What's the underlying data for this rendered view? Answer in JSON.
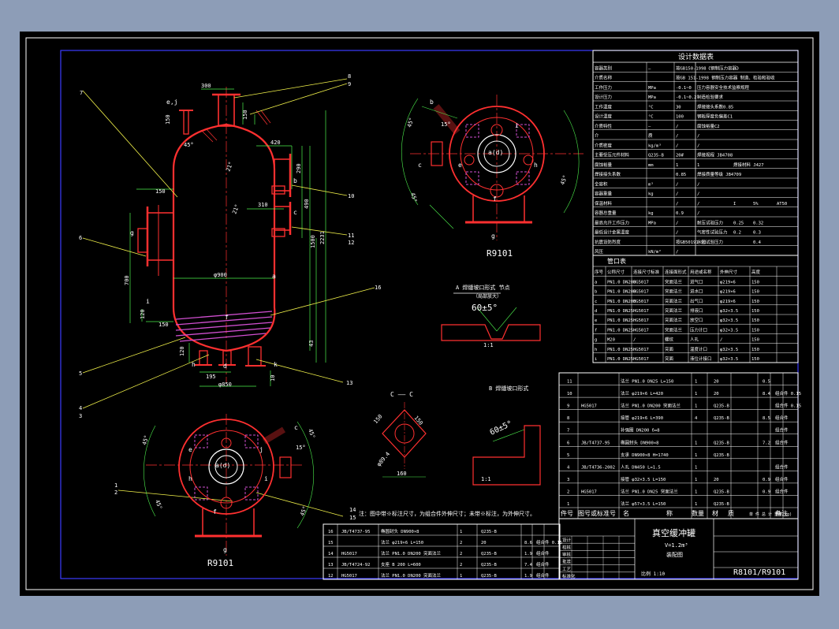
{
  "colors": {
    "background": "#8d9db7",
    "sheet": "#000000",
    "vessel": "#ff3030",
    "dimension": "#4df04d",
    "leader": "#f2f24a",
    "border_inner": "#3c3cff",
    "table": "#ffffff",
    "nozzle_hatch": "#d04fd0",
    "centerline": "#ff3030",
    "flange": "#b060ff"
  },
  "front_view": {
    "dims": {
      "d300": "300",
      "d150a": "150",
      "d150b": "150",
      "d420": "420",
      "d290": "290",
      "d310": "310",
      "d490": "490",
      "d1500": "1500",
      "d2231": "2231",
      "d150c": "150",
      "d700": "700",
      "d900": "φ900",
      "d120": "120",
      "d150d": "150",
      "d120b": "120",
      "d195": "195",
      "d850": "φ850",
      "d10": "10",
      "d43": "43",
      "d45": "45°",
      "angle21a": "21°",
      "angle21b": "21°"
    },
    "letters": {
      "ej": "e,j",
      "b": "b",
      "c": "c",
      "g": "g",
      "a": "a",
      "d": "d",
      "h": "h",
      "i": "i",
      "k": "k",
      "f": "f"
    },
    "callouts": [
      "7",
      "8",
      "9",
      "10",
      "11",
      "12",
      "6",
      "16",
      "5",
      "13",
      "4",
      "3",
      "1",
      "2",
      "14",
      "15"
    ]
  },
  "top_view": {
    "label": "R9101",
    "letters": [
      "b",
      "c",
      "e",
      "a(d)",
      "h",
      "f",
      "g",
      "i"
    ],
    "angles": [
      "45°",
      "45°",
      "15°",
      "45°"
    ]
  },
  "bottom_view": {
    "label": "R9101",
    "letters": [
      "e",
      "a(d)",
      "j",
      "h",
      "f",
      "g",
      "i",
      "c"
    ],
    "angles": [
      "45°",
      "45°",
      "15°",
      "45°",
      "45°"
    ]
  },
  "details": {
    "weld_a_title": "A 焊缝坡口形式 节点",
    "weld_a_sub": "（局部放大）",
    "weld_a_angle": "60±5°",
    "weld_a_scale": "1:1",
    "section_c_title": "C —— C",
    "section_c_dims": [
      "150",
      "150",
      "160",
      "φ89.4"
    ],
    "weld_b_title": "B 焊缝坡口形式",
    "weld_b_angle": "60±5°",
    "weld_b_scale": "1:1"
  },
  "design_table": {
    "title": "设计数据表",
    "rows": [
      [
        "容器类别",
        "—",
        "按GB150-1998《钢制压力容器》"
      ],
      [
        "介质名称",
        "",
        "按GB 151-1998 钢制压力容器 制造、检验和验收"
      ],
      [
        "工作压力",
        "MPa",
        "-0.1~0",
        "压力容器安全技术监察规程"
      ],
      [
        "设计压力",
        "MPa",
        "-0.1~0.2",
        "制造检验要求"
      ],
      [
        "工作温度",
        "°C",
        "30",
        "焊接接头系数0.85"
      ],
      [
        "设计温度",
        "°C",
        "100",
        "钢板厚度负偏差C1"
      ],
      [
        "介质特性",
        "—",
        "/",
        "腐蚀裕量C2"
      ],
      [
        "介",
        "质",
        "/",
        "/"
      ],
      [
        "介质密度",
        "kg/m³",
        "/",
        "/"
      ],
      [
        "主要受压元件材料",
        "Q235-B",
        "20#",
        "焊接规程 JB4708"
      ],
      [
        "腐蚀裕量",
        "mm",
        "1",
        "1",
        "焊接材料 J427"
      ],
      [
        "焊接接头系数",
        "",
        "0.85",
        "焊接质量等级 JB4709"
      ],
      [
        "全容积",
        "m³",
        "/",
        "/"
      ],
      [
        "容器重量",
        "kg",
        "/",
        "/"
      ],
      [
        "保温材料",
        "",
        "/",
        "/",
        "I",
        "5%",
        "AT50",
        "I-II"
      ],
      [
        "容器总重量",
        "kg",
        "0.9",
        "/"
      ],
      [
        "最高允许工作压力",
        "MPa",
        "/",
        "耐压试验压力",
        "0.25",
        "0.32"
      ],
      [
        "最低设计金属温度",
        "",
        "/",
        "气密性试验压力",
        "0.2",
        "0.3"
      ],
      [
        "抗震设防烈度",
        "",
        "按GB50191-93",
        "水压试验压力",
        "",
        "0.4"
      ],
      [
        "风压",
        "kN/m²",
        "/",
        "",
        "",
        ""
      ]
    ]
  },
  "nozzle_table": {
    "title": "管口表",
    "headers": [
      "序号",
      "公称尺寸",
      "连接尺寸标准",
      "连接面形式",
      "用途或名称",
      "外伸尺寸",
      "高度"
    ],
    "rows": [
      [
        "a",
        "PN1.0 DN200",
        "HG5017",
        "突面法兰",
        "进气口",
        "φ219×6",
        "150"
      ],
      [
        "b",
        "PN1.0 DN200",
        "HG5017",
        "突面法兰",
        "进水口",
        "φ219×6",
        "150"
      ],
      [
        "c",
        "PN1.0 DN200",
        "HG5017",
        "突面法兰",
        "出气口",
        "φ219×6",
        "150"
      ],
      [
        "d",
        "PN1.0 DN25",
        "HG5017",
        "突面法兰",
        "排液口",
        "φ32×3.5",
        "150"
      ],
      [
        "e",
        "PN1.0 DN25",
        "HG5017",
        "突面法兰",
        "放空口",
        "φ32×3.5",
        "150"
      ],
      [
        "f",
        "PN1.0 DN25",
        "HG5017",
        "突面法兰",
        "压力计口",
        "φ32×3.5",
        "150"
      ],
      [
        "g",
        "M20",
        "/",
        "螺纹",
        "人孔",
        "/",
        "150"
      ],
      [
        "h",
        "PN1.0 DN25",
        "HG5017",
        "突面",
        "温度计口",
        "φ32×3.5",
        "150"
      ],
      [
        "i",
        "PN1.0 DN25",
        "HG5017",
        "突面",
        "液位计接口",
        "φ32×3.5",
        "150"
      ]
    ]
  },
  "parts_list_upper": {
    "rows": [
      [
        "11",
        "",
        "法兰 PN1.0 DN25 L=150",
        "1",
        "20",
        "",
        "0.5",
        ""
      ],
      [
        "10",
        "",
        "法兰 φ219×6 L=420",
        "1",
        "20",
        "",
        "8.4",
        "组合件 0.15"
      ],
      [
        "9",
        "HG5017",
        "法兰 PN1.0 DN200 突面法兰",
        "1",
        "Q235-B",
        "",
        "",
        "组合件 0.15"
      ],
      [
        "8",
        "",
        "接管 φ219×6 L=390",
        "4",
        "Q235-B",
        "",
        "8.5",
        "组合件"
      ],
      [
        "7",
        "",
        "补强圈 DN200 δ=8",
        "",
        "",
        "",
        "",
        "组合件"
      ],
      [
        "6",
        "JB/T4737-95",
        "椭圆封头 DN900×8",
        "1",
        "Q235-B",
        "",
        "7.2",
        "组合件"
      ],
      [
        "5",
        "",
        "支承 DN900×8 H=1740",
        "1",
        "Q235-B",
        "",
        "",
        ""
      ],
      [
        "4",
        "JB/T4736-2002",
        "人孔 DN450 L=1.5",
        "1",
        "",
        "",
        "",
        "组合件"
      ],
      [
        "3",
        "",
        "接管 φ32×3.5 L=150",
        "1",
        "20",
        "",
        "0.9",
        "组合件"
      ],
      [
        "2",
        "HG5017",
        "法兰 PN1.0 DN25 突面法兰",
        "1",
        "Q235-B",
        "",
        "0.9",
        "组合件"
      ],
      [
        "1",
        "",
        "法兰 φ57×3.5 L=150",
        "1",
        "Q235-B",
        "",
        "",
        ""
      ]
    ],
    "headers": [
      "件号",
      "图号或标准号",
      "名",
      "称",
      "数量",
      "材",
      "质",
      "单 件 总 计 重量(kg)",
      "备注"
    ]
  },
  "parts_list_lower": {
    "note": "注：图中带※标注尺寸，为组合件外伸尺寸；未带※标注，为外伸尺寸。",
    "rows": [
      [
        "16",
        "JB/T4737-95",
        "椭圆封头 DN900×8",
        "1",
        "Q235-B",
        "",
        "",
        ""
      ],
      [
        "15",
        "",
        "法兰 φ219×6 L=150",
        "2",
        "20",
        "8.6",
        "组合件 0.15",
        ""
      ],
      [
        "14",
        "HG5017",
        "法兰 PN1.0 DN200 突面法兰",
        "2",
        "Q235-B",
        "1.9",
        "组合件",
        ""
      ],
      [
        "13",
        "JB/T4724-92",
        "支座 B 200 L=600",
        "2",
        "Q235-B",
        "7.4",
        "组合件",
        ""
      ],
      [
        "12",
        "HG5017",
        "法兰 PN1.0 DN200 突面法兰",
        "1",
        "Q235-B",
        "1.9",
        "组合件",
        ""
      ]
    ]
  },
  "title_block": {
    "title": "真空缓冲罐",
    "sub1": "V=1.2m³",
    "sub2": "装配图",
    "scale": "比例 1:10",
    "drawing_no": "R8101/R9101",
    "rows": [
      "设计",
      "校核",
      "审核",
      "批准",
      "工艺",
      "标准化"
    ]
  }
}
